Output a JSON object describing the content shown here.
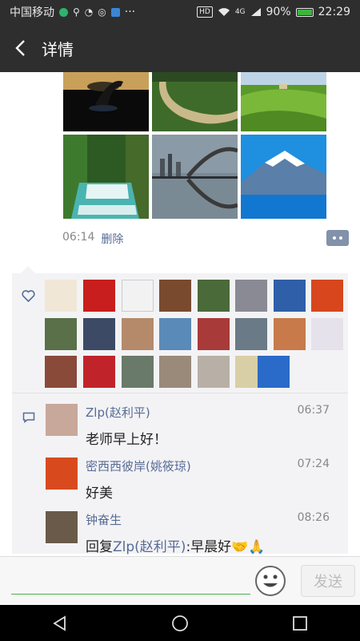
{
  "status_bar": {
    "carrier": "中国移动",
    "battery": "90%",
    "time": "22:29",
    "network": "4G",
    "hd": "HD",
    "more": "···"
  },
  "header": {
    "title": "详情",
    "icon": "back-arrow-icon"
  },
  "post": {
    "time": "06:14",
    "delete_label": "删除",
    "photos": [
      "heron at sunset",
      "green valley river",
      "green hills farm",
      "forest waterfall",
      "city bridge reflection",
      "snowy mountain lake"
    ]
  },
  "likes": {
    "icon": "heart-icon",
    "count": 23
  },
  "comments": [
    {
      "name": "Zlp(赵利平)",
      "time": "06:37",
      "text": "老师早上好！"
    },
    {
      "name": "密西西彼岸(姚筱琼)",
      "time": "07:24",
      "text": "好美"
    },
    {
      "name": "钟奋生",
      "time": "08:26",
      "reply_prefix": "回复",
      "reply_to": "Zlp(赵利平)",
      "text": ":早晨好🤝🙏"
    }
  ],
  "input_bar": {
    "placeholder": "",
    "send_label": "发送",
    "emoji_icon": "smiley-icon"
  },
  "colors": {
    "accent": "#576b95",
    "header_bg": "#2e2e2e",
    "panel_bg": "#f3f3f5",
    "input_line": "#4caf50"
  }
}
